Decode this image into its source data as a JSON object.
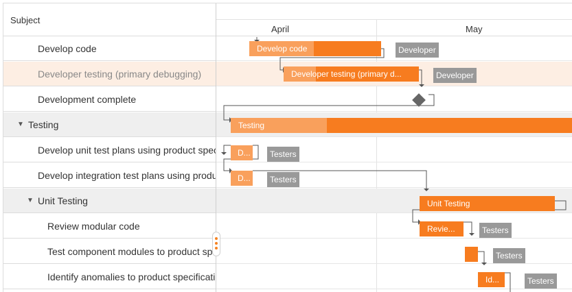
{
  "grid": {
    "subject_header": "Subject"
  },
  "timeline": {
    "months": [
      "April",
      "May"
    ]
  },
  "rows": [
    {
      "subject": "Develop code",
      "highlighted": false,
      "summary": false,
      "indent": 2,
      "bar_label": "Develop code",
      "progress_pct": 44,
      "resource": "Developer"
    },
    {
      "subject": "Developer testing (primary debugging)",
      "highlighted": true,
      "summary": false,
      "indent": 2,
      "bar_label": "Developer testing (primary d...",
      "progress_pct": 24,
      "resource": "Developer"
    },
    {
      "subject": "Development complete",
      "highlighted": false,
      "summary": false,
      "indent": 2,
      "milestone": true
    },
    {
      "subject": "Testing",
      "highlighted": false,
      "summary": true,
      "expanded": true,
      "indent": 1,
      "bar_label": "Testing",
      "progress_pct": 28
    },
    {
      "subject": "Develop unit test plans using product specifications",
      "highlighted": false,
      "summary": false,
      "indent": 2,
      "bar_label": "D...",
      "progress_pct": 100,
      "resource": "Testers"
    },
    {
      "subject": "Develop integration test plans using product specifications",
      "highlighted": false,
      "summary": false,
      "indent": 2,
      "bar_label": "D...",
      "progress_pct": 100,
      "resource": "Testers"
    },
    {
      "subject": "Unit Testing",
      "highlighted": false,
      "summary": true,
      "expanded": true,
      "indent": 2,
      "bar_label": "Unit Testing",
      "progress_pct": 0
    },
    {
      "subject": "Review modular code",
      "highlighted": false,
      "summary": false,
      "indent": 3,
      "bar_label": "Revie...",
      "progress_pct": 0,
      "resource": "Testers"
    },
    {
      "subject": "Test component modules to product specifications",
      "highlighted": false,
      "summary": false,
      "indent": 3,
      "bar_label": "",
      "progress_pct": 0,
      "resource": "Testers"
    },
    {
      "subject": "Identify anomalies to product specifications",
      "highlighted": false,
      "summary": false,
      "indent": 3,
      "bar_label": "Id...",
      "progress_pct": 0,
      "resource": "Testers"
    }
  ],
  "colors": {
    "task": "#f77c1f",
    "progress": "#f9a05c",
    "resource": "#999999",
    "highlight_row": "#fdeee3",
    "summary_row": "#efefef",
    "milestone": "#666666"
  },
  "icons": {
    "collapse": "caret-down-icon",
    "resize": "splitter-handle-icon"
  }
}
